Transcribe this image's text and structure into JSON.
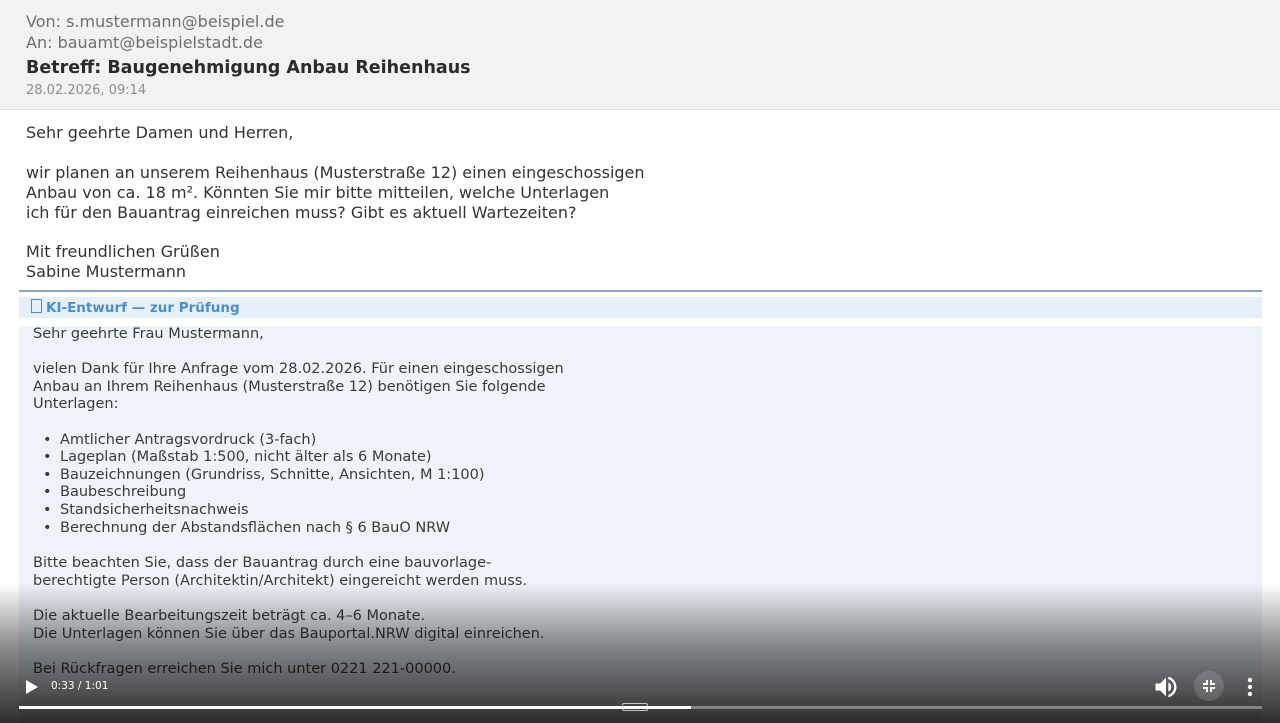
{
  "email": {
    "from": "Von: s.mustermann@beispiel.de",
    "to": "An: bauamt@beispielstadt.de",
    "subject": "Betreff: Baugenehmigung Anbau Reihenhaus",
    "date": "28.02.2026, 09:14",
    "body": [
      "Sehr geehrte Damen und Herren,",
      "wir planen an unserem Reihenhaus (Musterstraße 12) einen eingeschossigen",
      "Anbau von ca. 18 m². Könnten Sie mir bitte mitteilen, welche Unterlagen",
      "ich für den Bauantrag einreichen muss? Gibt es aktuell Wartezeiten?",
      "Mit freundlichen Grüßen",
      "Sabine Mustermann"
    ]
  },
  "draft": {
    "label": "KI-Entwurf — zur Prüfung",
    "greeting": "Sehr geehrte Frau Mustermann,",
    "intro": [
      "vielen Dank für Ihre Anfrage vom 28.02.2026. Für einen eingeschossigen",
      "Anbau an Ihrem Reihenhaus (Musterstraße 12) benötigen Sie folgende",
      "Unterlagen:"
    ],
    "items": [
      "Amtlicher Antragsvordruck (3-fach)",
      "Lageplan (Maßstab 1:500, nicht älter als 6 Monate)",
      "Bauzeichnungen (Grundriss, Schnitte, Ansichten, M 1:100)",
      "Baubeschreibung",
      "Standsicherheitsnachweis",
      "Berechnung der Abstandsflächen nach § 6 BauO NRW"
    ],
    "note": [
      "Bitte beachten Sie, dass der Bauantrag durch eine bauvorlage-",
      "berechtigte Person (Architektin/Architekt) eingereicht werden muss."
    ],
    "timing": [
      "Die aktuelle Bearbeitungszeit beträgt ca. 4–6 Monate.",
      "Die Unterlagen können Sie über das Bauportal.NRW digital einreichen."
    ],
    "contact": "Bei Rückfragen erreichen Sie mich unter 0221 221-00000."
  },
  "player": {
    "time": "0:33 / 1:01",
    "progress_fraction": 0.541,
    "icons": [
      "play-icon",
      "volume-icon",
      "exit-fullscreen-icon",
      "more-vert-icon"
    ]
  },
  "colors": {
    "accent": "#4a90c8",
    "draft_bg": "#eef3f9",
    "header_bg": "#f2f2f2"
  }
}
